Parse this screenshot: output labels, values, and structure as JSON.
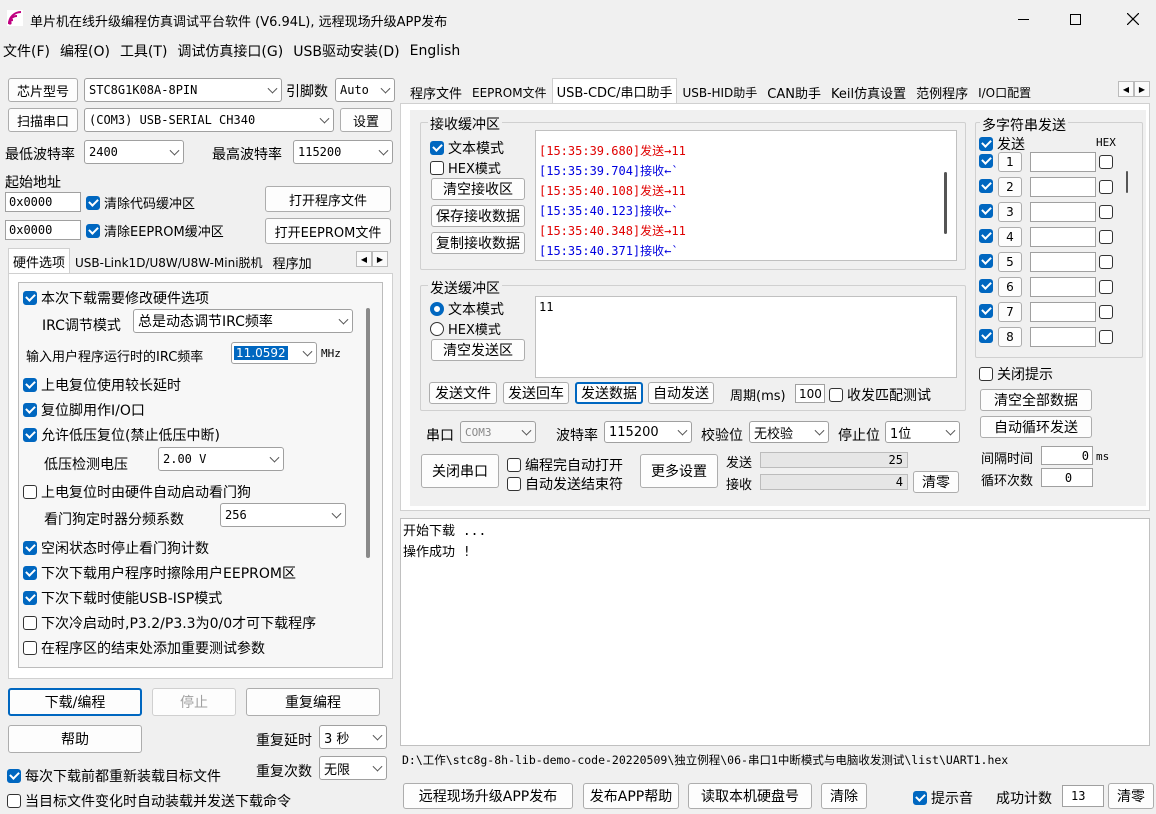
{
  "window": {
    "title": "单片机在线升级编程仿真调试平台软件 (V6.94L), 远程现场升级APP发布"
  },
  "menu": [
    "文件(F)",
    "编程(O)",
    "工具(T)",
    "调试仿真接口(G)",
    "USB驱动安装(D)",
    "English"
  ],
  "left": {
    "chip_label": "芯片型号",
    "chip_value": "STC8G1K08A-8PIN",
    "pins_label": "引脚数",
    "pins_value": "Auto",
    "scan_label": "扫描串口",
    "port_value": "(COM3) USB-SERIAL CH340",
    "settings_label": "设置",
    "min_baud_label": "最低波特率",
    "min_baud_value": "2400",
    "max_baud_label": "最高波特率",
    "max_baud_value": "115200",
    "start_addr_label": "起始地址",
    "addr1": "0x0000",
    "addr2": "0x0000",
    "clear_code": "清除代码缓冲区",
    "clear_eeprom": "清除EEPROM缓冲区",
    "open_prog": "打开程序文件",
    "open_eeprom": "打开EEPROM文件",
    "tabs": [
      "硬件选项",
      "USB-Link1D/U8W/U8W-Mini脱机",
      "程序加"
    ],
    "hw": {
      "opt1": "本次下载需要修改硬件选项",
      "irc_mode_label": "IRC调节模式",
      "irc_mode_value": "总是动态调节IRC频率",
      "irc_freq_label": "输入用户程序运行时的IRC频率",
      "irc_freq_value": "11.0592",
      "irc_unit": "MHz",
      "opt2": "上电复位使用较长延时",
      "opt3": "复位脚用作I/O口",
      "opt4": "允许低压复位(禁止低压中断)",
      "lv_label": "低压检测电压",
      "lv_value": "2.00 V",
      "opt5": "上电复位时由硬件自动启动看门狗",
      "wdt_label": "看门狗定时器分频系数",
      "wdt_value": "256",
      "opt6": "空闲状态时停止看门狗计数",
      "opt7": "下次下载用户程序时擦除用户EEPROM区",
      "opt8": "下次下载时使能USB-ISP模式",
      "opt9": "下次冷启动时,P3.2/P3.3为0/0才可下载程序",
      "opt10": "在程序区的结束处添加重要测试参数"
    },
    "download": "下载/编程",
    "stop": "停止",
    "reprog": "重复编程",
    "help": "帮助",
    "delay_label": "重复延时",
    "delay_value": "3 秒",
    "count_label": "重复次数",
    "count_value": "无限",
    "reload1": "每次下载前都重新装载目标文件",
    "reload2": "当目标文件变化时自动装载并发送下载命令"
  },
  "right": {
    "tabs": [
      "程序文件",
      "EEPROM文件",
      "USB-CDC/串口助手",
      "USB-HID助手",
      "CAN助手",
      "Keil仿真设置",
      "范例程序",
      "I/O口配置"
    ],
    "recv": {
      "title": "接收缓冲区",
      "text_mode": "文本模式",
      "hex_mode": "HEX模式",
      "clear": "清空接收区",
      "save": "保存接收数据",
      "copy": "复制接收数据",
      "log": [
        {
          "t": "[15:35:39.680]发送→11",
          "c": "red"
        },
        {
          "t": "[15:35:39.704]接收←`",
          "c": "blue"
        },
        {
          "t": "[15:35:40.108]发送→11",
          "c": "red"
        },
        {
          "t": "[15:35:40.123]接收←`",
          "c": "blue"
        },
        {
          "t": "[15:35:40.348]发送→11",
          "c": "red"
        },
        {
          "t": "[15:35:40.371]接收←`",
          "c": "blue"
        }
      ]
    },
    "send": {
      "title": "发送缓冲区",
      "text_mode": "文本模式",
      "hex_mode": "HEX模式",
      "clear": "清空发送区",
      "content": "11",
      "send_file": "发送文件",
      "send_cr": "发送回车",
      "send_data": "发送数据",
      "auto_send": "自动发送",
      "period_label": "周期(ms)",
      "period_value": "100",
      "match_test": "收发匹配测试"
    },
    "port": {
      "port_label": "串口",
      "port_value": "COM3",
      "baud_label": "波特率",
      "baud_value": "115200",
      "parity_label": "校验位",
      "parity_value": "无校验",
      "stop_label": "停止位",
      "stop_value": "1位",
      "close": "关闭串口",
      "auto_open": "编程完自动打开",
      "auto_close": "自动发送结束符",
      "more": "更多设置",
      "sent_label": "发送",
      "sent_value": "25",
      "recv_label": "接收",
      "recv_value": "4",
      "clear": "清零"
    },
    "multi": {
      "title": "多字符串发送",
      "send_label": "发送",
      "hex_label": "HEX",
      "rows": [
        "1",
        "2",
        "3",
        "4",
        "5",
        "6",
        "7",
        "8"
      ],
      "close_tip": "关闭提示",
      "clear_all": "清空全部数据",
      "auto_loop": "自动循环发送",
      "interval_label": "间隔时间",
      "interval_value": "0",
      "interval_unit": "ms",
      "loop_label": "循环次数",
      "loop_value": "0"
    },
    "output": [
      "开始下载 ...",
      "操作成功 !"
    ],
    "path": "D:\\工作\\stc8g-8h-lib-demo-code-20220509\\独立例程\\06-串口1中断模式与电脑收发测试\\list\\UART1.hex",
    "bottom": {
      "remote": "远程现场升级APP发布",
      "app_help": "发布APP帮助",
      "read_disk": "读取本机硬盘号",
      "clear": "清除",
      "tone": "提示音",
      "success_label": "成功计数",
      "success_value": "13",
      "reset": "清零"
    }
  }
}
